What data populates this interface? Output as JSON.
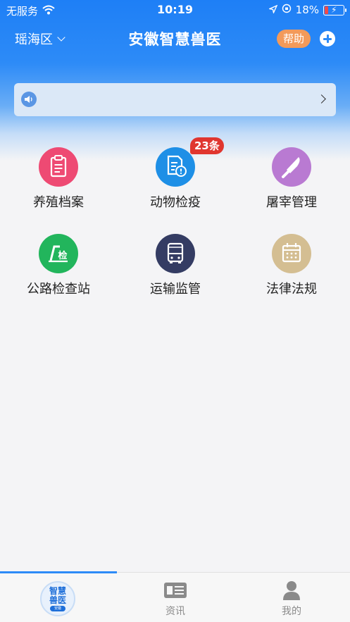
{
  "status_bar": {
    "carrier": "无服务",
    "time": "10:19",
    "battery_percent": "18%"
  },
  "navbar": {
    "region": "瑶海区",
    "title": "安徽智慧兽医",
    "help_label": "帮助"
  },
  "notice": {
    "icon": "speaker-icon"
  },
  "menu": {
    "items": [
      {
        "label": "养殖档案",
        "icon": "clipboard-icon",
        "color": "#ee4a73"
      },
      {
        "label": "动物检疫",
        "icon": "document-alert-icon",
        "color": "#1e8fe6",
        "badge": "23条"
      },
      {
        "label": "屠宰管理",
        "icon": "knife-icon",
        "color": "#b97ad2"
      },
      {
        "label": "公路检查站",
        "icon": "checkpoint-icon",
        "color": "#22b55c"
      },
      {
        "label": "运输监管",
        "icon": "bus-icon",
        "color": "#343c63"
      },
      {
        "label": "法律法规",
        "icon": "calendar-icon",
        "color": "#d4be92"
      }
    ]
  },
  "tabbar": {
    "home_logo": {
      "line1": "智慧",
      "line2": "兽医",
      "sub": "安徽"
    },
    "news_label": "资讯",
    "mine_label": "我的",
    "accent": "#2d8bf7"
  }
}
